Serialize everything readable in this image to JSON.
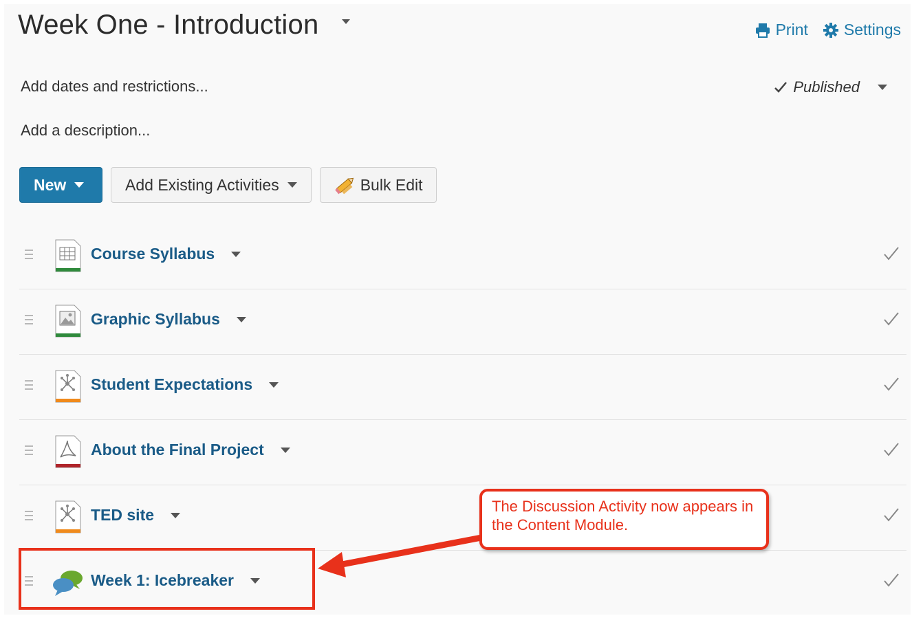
{
  "header": {
    "title": "Week One - Introduction",
    "print_label": "Print",
    "settings_label": "Settings"
  },
  "module": {
    "dates_link": "Add dates and restrictions...",
    "description_link": "Add a description...",
    "status": "Published"
  },
  "toolbar": {
    "new_label": "New",
    "add_existing_label": "Add Existing Activities",
    "bulk_edit_label": "Bulk Edit"
  },
  "items": [
    {
      "label": "Course Syllabus",
      "icon": "spreadsheet-file-icon",
      "color": "#2f8a3c"
    },
    {
      "label": "Graphic Syllabus",
      "icon": "image-file-icon",
      "color": "#2f8a3c"
    },
    {
      "label": "Student Expectations",
      "icon": "web-link-icon",
      "color": "#f08a1c"
    },
    {
      "label": "About the Final Project",
      "icon": "pdf-file-icon",
      "color": "#b0242a"
    },
    {
      "label": "TED site",
      "icon": "web-link-icon",
      "color": "#f08a1c"
    },
    {
      "label": "Week 1: Icebreaker",
      "icon": "discussion-icon",
      "color": "#6aa82e"
    }
  ],
  "annotation": {
    "callout_text": "The Discussion Activity now appears in the Content Module.",
    "color": "#e8311b"
  },
  "colors": {
    "link": "#1a5b87",
    "primary": "#1f7aaa"
  }
}
